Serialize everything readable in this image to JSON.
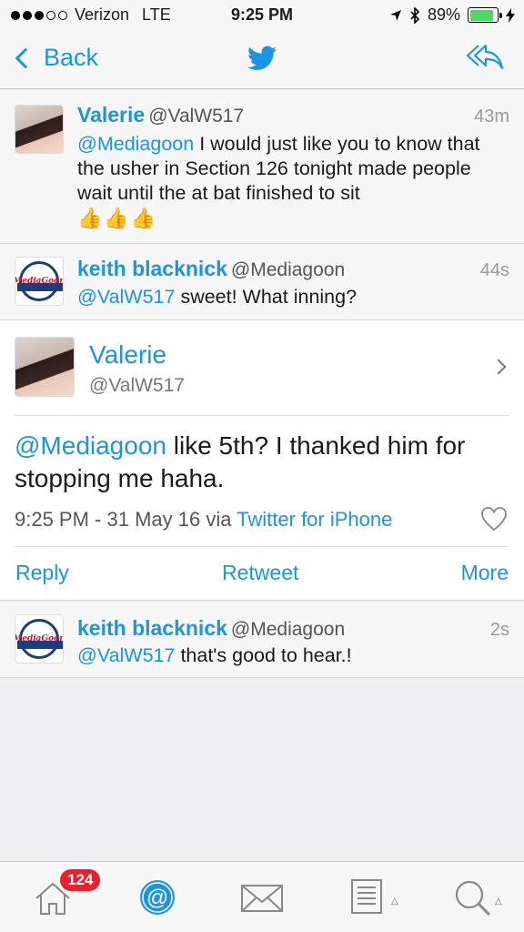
{
  "status": {
    "carrier": "Verizon",
    "network": "LTE",
    "time": "9:25 PM",
    "battery": "89%",
    "battery_level": 0.89
  },
  "nav": {
    "back_label": "Back",
    "center_icon": "twitter-bird-icon",
    "right_icon": "reply-all-icon"
  },
  "tweets": [
    {
      "name": "Valerie",
      "handle": "@ValW517",
      "time": "43m",
      "mention": "@Mediagoon",
      "text": " I would just like you to know that the usher in Section 126 tonight made people wait until the at bat finished to sit",
      "emoji": "👍👍👍"
    },
    {
      "name": "keith blacknick",
      "handle": "@Mediagoon",
      "time": "44s",
      "mention": "@ValW517",
      "text": " sweet! What inning?"
    }
  ],
  "detail": {
    "name": "Valerie",
    "handle": "@ValW517",
    "mention": "@Mediagoon",
    "text": " like 5th?  I thanked him for stopping me haha.",
    "timestamp": "9:25 PM - 31 May 16 via ",
    "via_app": "Twitter for iPhone",
    "actions": {
      "reply": "Reply",
      "retweet": "Retweet",
      "more": "More"
    }
  },
  "reply": {
    "name": "keith blacknick",
    "handle": "@Mediagoon",
    "time": "2s",
    "mention": "@ValW517",
    "text": " that's good to hear.!"
  },
  "keith_avatar_logo": "MediaGoon",
  "tabbar": {
    "home_badge": "124",
    "tabs": [
      "home-icon",
      "mentions-icon",
      "messages-icon",
      "lists-icon",
      "search-icon"
    ]
  },
  "colors": {
    "accent": "#1b95e0",
    "badge": "#e8212c",
    "battery": "#4cd964"
  }
}
